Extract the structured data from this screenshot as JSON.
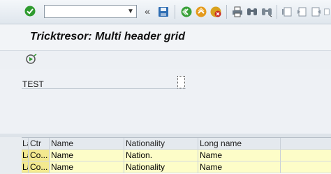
{
  "toolbar": {
    "command_value": "",
    "icons": [
      "enter-check-icon",
      "command-dropdown-icon",
      "collapse-icon",
      "save-icon",
      "back-icon",
      "exit-icon",
      "cancel-icon",
      "print-icon",
      "find-icon",
      "find-next-icon",
      "first-page-icon",
      "previous-page-icon",
      "next-page-icon",
      "last-page-icon"
    ],
    "collapse_glyph": "«"
  },
  "title": "Tricktresor: Multi header grid",
  "app_toolbar": {
    "execute_icon": "execute-icon"
  },
  "content": {
    "test_label": "TEST"
  },
  "grid": {
    "columns": [
      "La",
      "Ctr",
      "Name",
      "Nationality",
      "Long name",
      ""
    ],
    "rows": [
      [
        "La",
        "Co...",
        "Name",
        "Nation.",
        "Name",
        ""
      ],
      [
        "La",
        "Co...",
        "Name",
        "Nationality",
        "Name",
        ""
      ]
    ]
  },
  "colors": {
    "row_background": "#fdfdc8",
    "key_cell_background": "#f3e98f",
    "header_background": "#e4e9ee"
  }
}
